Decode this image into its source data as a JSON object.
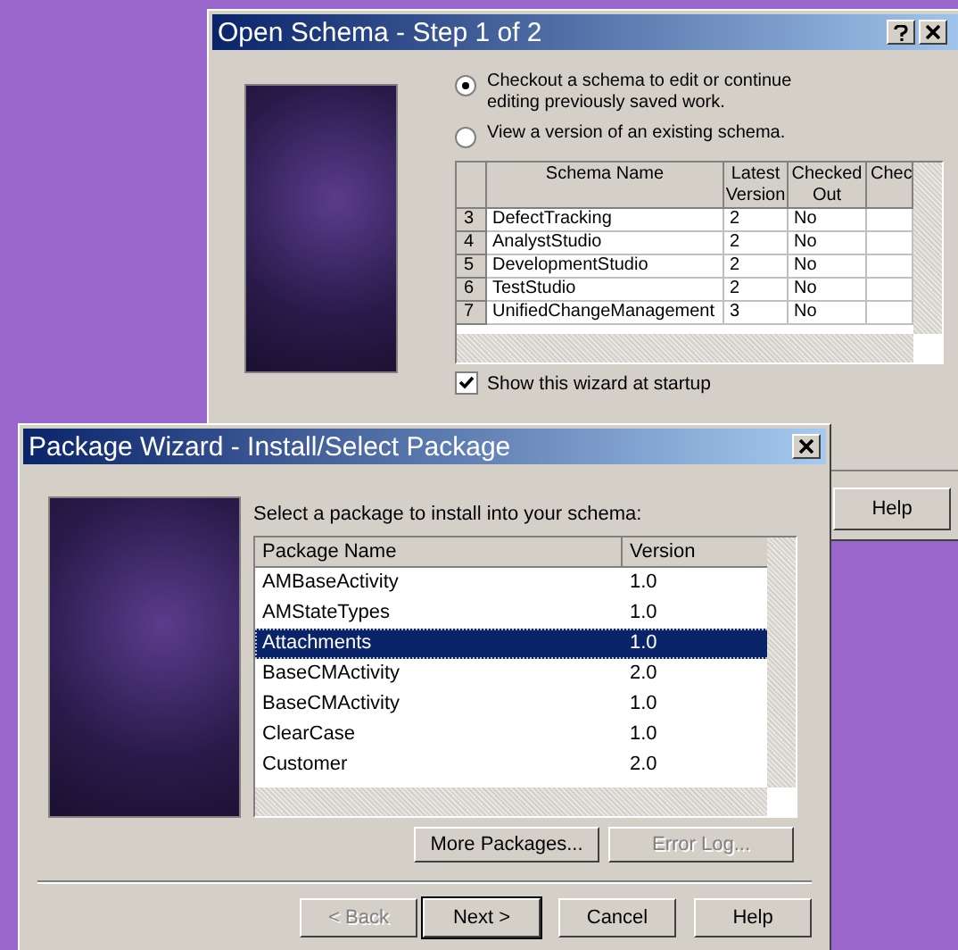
{
  "schema_window": {
    "title": "Open Schema - Step 1 of 2",
    "options": [
      {
        "label": "Checkout a schema to edit or continue editing previously saved work.",
        "selected": true
      },
      {
        "label": "View a version of an existing schema.",
        "selected": false
      }
    ],
    "table": {
      "columns": [
        "",
        "Schema Name",
        "Latest Version",
        "Checked Out",
        "Chec"
      ],
      "rows": [
        [
          "3",
          "DefectTracking",
          "2",
          "No",
          ""
        ],
        [
          "4",
          "AnalystStudio",
          "2",
          "No",
          ""
        ],
        [
          "5",
          "DevelopmentStudio",
          "2",
          "No",
          ""
        ],
        [
          "6",
          "TestStudio",
          "2",
          "No",
          ""
        ],
        [
          "7",
          "UnifiedChangeManagement",
          "3",
          "No",
          ""
        ]
      ]
    },
    "startup_checkbox": {
      "label": "Show this wizard at startup",
      "checked": true
    },
    "help_button": "Help"
  },
  "package_window": {
    "title": "Package Wizard - Install/Select Package",
    "prompt": "Select a package to install into your schema:",
    "columns": [
      "Package Name",
      "Version"
    ],
    "packages": [
      {
        "name": "AMBaseActivity",
        "version": "1.0",
        "selected": false
      },
      {
        "name": "AMStateTypes",
        "version": "1.0",
        "selected": false
      },
      {
        "name": "Attachments",
        "version": "1.0",
        "selected": true
      },
      {
        "name": "BaseCMActivity",
        "version": "2.0",
        "selected": false
      },
      {
        "name": "BaseCMActivity",
        "version": "1.0",
        "selected": false
      },
      {
        "name": "ClearCase",
        "version": "1.0",
        "selected": false
      },
      {
        "name": "Customer",
        "version": "2.0",
        "selected": false
      }
    ],
    "list_buttons": [
      {
        "label": "More Packages...",
        "disabled": false
      },
      {
        "label": "Error Log...",
        "disabled": true
      }
    ],
    "nav_buttons": [
      {
        "label": "< Back",
        "disabled": true,
        "default": false
      },
      {
        "label": "Next >",
        "disabled": false,
        "default": true
      },
      {
        "label": "Cancel",
        "disabled": false,
        "default": false
      },
      {
        "label": "Help",
        "disabled": false,
        "default": false
      }
    ]
  }
}
